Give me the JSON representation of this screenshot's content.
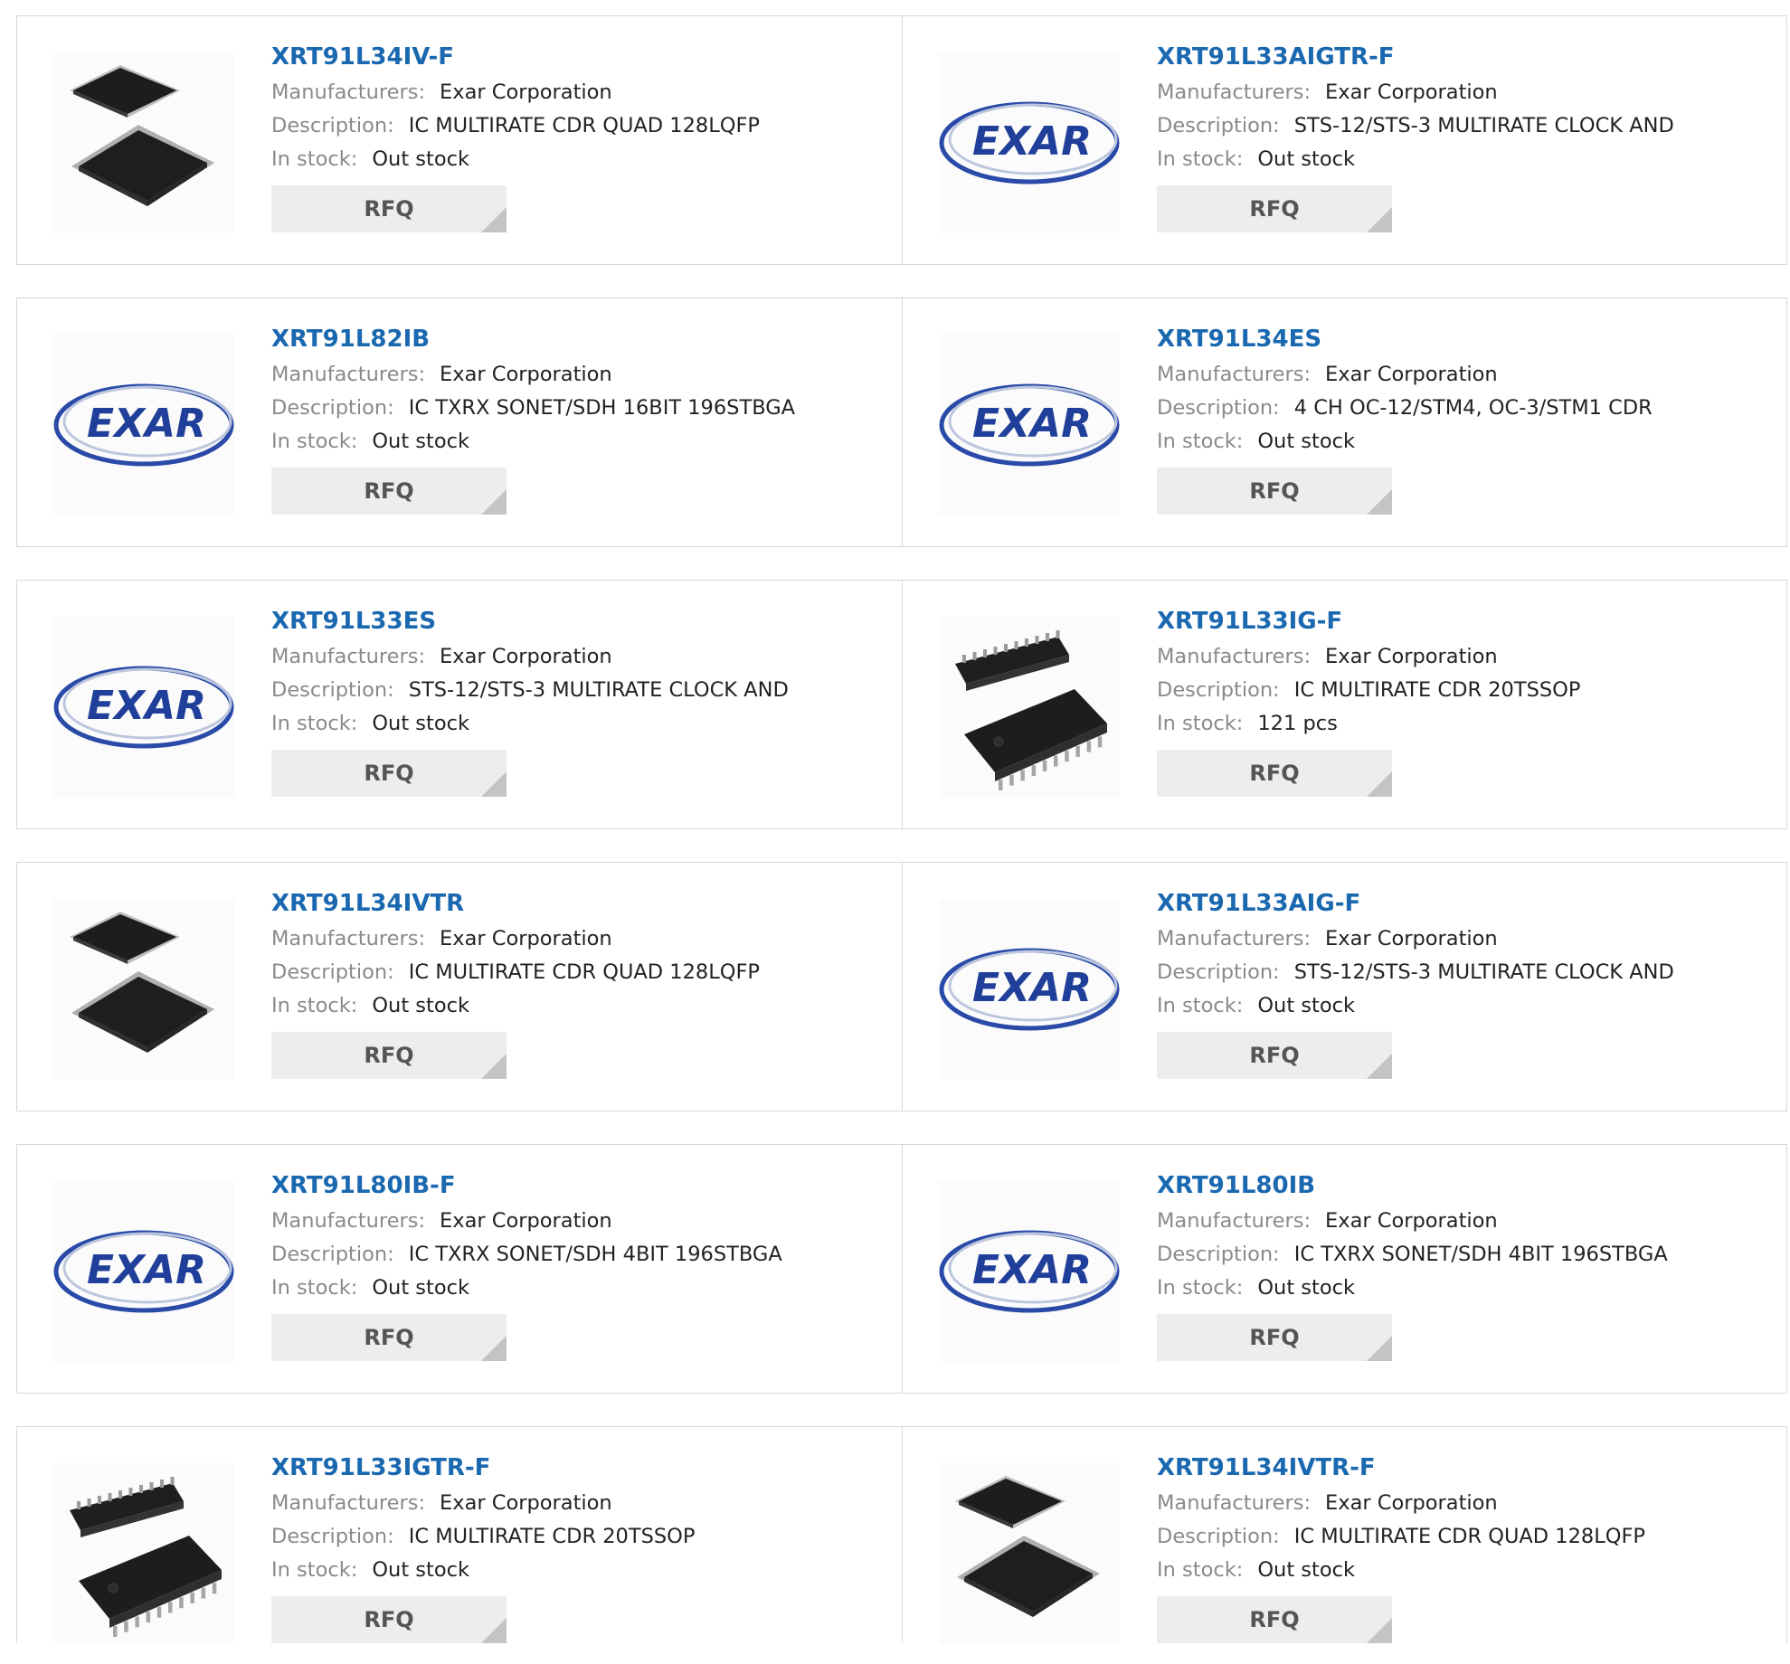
{
  "labels": {
    "manufacturers": "Manufacturers:",
    "description": "Description:",
    "in_stock": "In stock:"
  },
  "products": [
    {
      "part": "XRT91L34IV-F",
      "manufacturer": "Exar Corporation",
      "description": "IC MULTIRATE CDR QUAD 128LQFP",
      "stock": "Out stock",
      "rfq": "RFQ",
      "image": "lqfp-chip-icon"
    },
    {
      "part": "XRT91L33AIGTR-F",
      "manufacturer": "Exar Corporation",
      "description": "STS-12/STS-3 MULTIRATE CLOCK AND",
      "stock": "Out stock",
      "rfq": "RFQ",
      "image": "exar-logo"
    },
    {
      "part": "XRT91L82IB",
      "manufacturer": "Exar Corporation",
      "description": "IC TXRX SONET/SDH 16BIT 196STBGA",
      "stock": "Out stock",
      "rfq": "RFQ",
      "image": "exar-logo"
    },
    {
      "part": "XRT91L34ES",
      "manufacturer": "Exar Corporation",
      "description": "4 CH OC-12/STM4, OC-3/STM1 CDR",
      "stock": "Out stock",
      "rfq": "RFQ",
      "image": "exar-logo"
    },
    {
      "part": "XRT91L33ES",
      "manufacturer": "Exar Corporation",
      "description": "STS-12/STS-3 MULTIRATE CLOCK AND",
      "stock": "Out stock",
      "rfq": "RFQ",
      "image": "exar-logo"
    },
    {
      "part": "XRT91L33IG-F",
      "manufacturer": "Exar Corporation",
      "description": "IC MULTIRATE CDR 20TSSOP",
      "stock": "121 pcs",
      "rfq": "RFQ",
      "image": "tssop-chip-icon"
    },
    {
      "part": "XRT91L34IVTR",
      "manufacturer": "Exar Corporation",
      "description": "IC MULTIRATE CDR QUAD 128LQFP",
      "stock": "Out stock",
      "rfq": "RFQ",
      "image": "lqfp-chip-icon"
    },
    {
      "part": "XRT91L33AIG-F",
      "manufacturer": "Exar Corporation",
      "description": "STS-12/STS-3 MULTIRATE CLOCK AND",
      "stock": "Out stock",
      "rfq": "RFQ",
      "image": "exar-logo"
    },
    {
      "part": "XRT91L80IB-F",
      "manufacturer": "Exar Corporation",
      "description": "IC TXRX SONET/SDH 4BIT 196STBGA",
      "stock": "Out stock",
      "rfq": "RFQ",
      "image": "exar-logo"
    },
    {
      "part": "XRT91L80IB",
      "manufacturer": "Exar Corporation",
      "description": "IC TXRX SONET/SDH 4BIT 196STBGA",
      "stock": "Out stock",
      "rfq": "RFQ",
      "image": "exar-logo"
    },
    {
      "part": "XRT91L33IGTR-F",
      "manufacturer": "Exar Corporation",
      "description": "IC MULTIRATE CDR 20TSSOP",
      "stock": "Out stock",
      "rfq": "RFQ",
      "image": "tssop-chip-icon"
    },
    {
      "part": "XRT91L34IVTR-F",
      "manufacturer": "Exar Corporation",
      "description": "IC MULTIRATE CDR QUAD 128LQFP",
      "stock": "Out stock",
      "rfq": "RFQ",
      "image": "lqfp-chip-icon"
    }
  ],
  "logo": {
    "text": "EXAR"
  },
  "colors": {
    "part_link": "#1a68b0",
    "label": "#8a8a8a",
    "value": "#222222",
    "rfq_bg": "#ededed",
    "border": "#d7d7d7",
    "logo_blue": "#1f3f9a"
  }
}
